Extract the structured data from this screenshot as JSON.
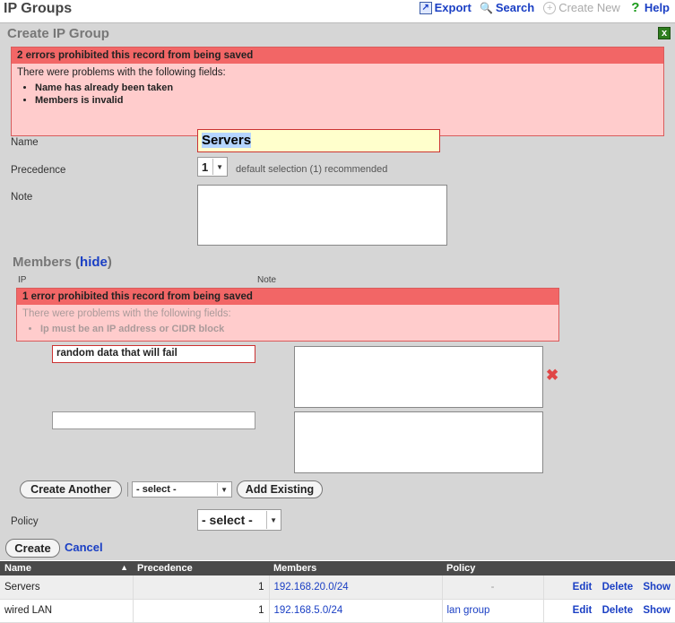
{
  "app": {
    "title": "IP Groups"
  },
  "toolbar": {
    "export": "Export",
    "search": "Search",
    "create_new": "Create New",
    "help": "Help"
  },
  "panel": {
    "title": "Create IP Group",
    "close": "x",
    "errors": {
      "heading": "2 errors prohibited this record from being saved",
      "intro": "There were problems with the following fields:",
      "items": [
        "Name has already been taken",
        "Members is invalid"
      ]
    },
    "form": {
      "name_label": "Name",
      "name_value": "Servers",
      "precedence_label": "Precedence",
      "precedence_value": "1",
      "precedence_hint": "default selection (1) recommended",
      "note_label": "Note",
      "members_title": "Members",
      "members_hide": "hide",
      "col_ip": "IP",
      "col_note": "Note",
      "member_errors": {
        "heading": "1 error prohibited this record from being saved",
        "intro": "There were problems with the following fields:",
        "items": [
          "Ip must be an IP address or CIDR block"
        ]
      },
      "member_rows": [
        {
          "ip": "random data that will fail",
          "note": ""
        },
        {
          "ip": "",
          "note": ""
        }
      ],
      "create_another": "Create Another",
      "existing_select": "- select -",
      "add_existing": "Add Existing",
      "policy_label": "Policy",
      "policy_value": "- select -",
      "create": "Create",
      "cancel": "Cancel"
    }
  },
  "table": {
    "headers": [
      "Name",
      "Precedence",
      "Members",
      "Policy",
      ""
    ],
    "rows": [
      {
        "name": "Servers",
        "precedence": "1",
        "members": "192.168.20.0/24",
        "policy": "-",
        "actions": [
          "Edit",
          "Delete",
          "Show"
        ]
      },
      {
        "name": "wired LAN",
        "precedence": "1",
        "members": "192.168.5.0/24",
        "policy": "lan group",
        "actions": [
          "Edit",
          "Delete",
          "Show"
        ]
      }
    ]
  }
}
